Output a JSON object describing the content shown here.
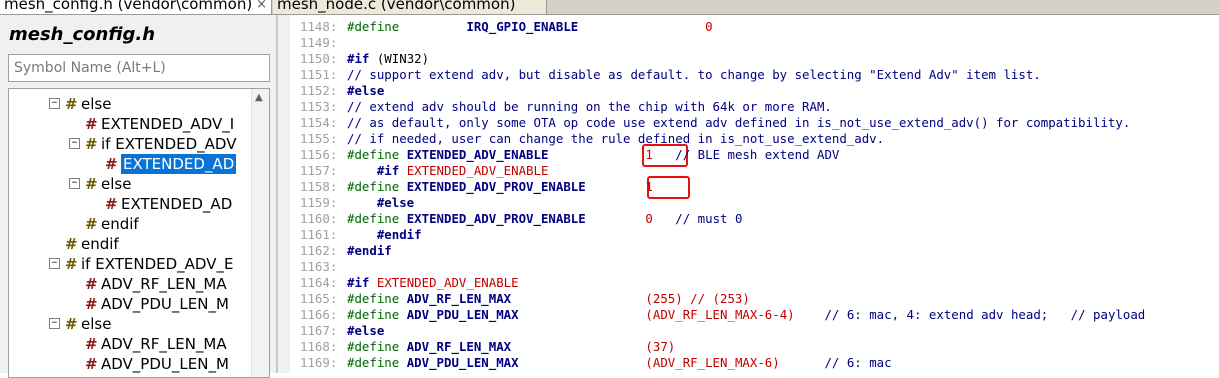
{
  "tabs": [
    {
      "label": "mesh_config.h (vendor\\common)",
      "active": true,
      "close": "×"
    },
    {
      "label": "mesh_node.c (vendor\\common)",
      "active": false
    }
  ],
  "sidebar": {
    "title": "mesh_config.h",
    "search_placeholder": "Symbol Name (Alt+L)",
    "tree": [
      {
        "label": "else",
        "kind": "cond",
        "expander": "−"
      },
      {
        "label": "EXTENDED_ADV_I",
        "kind": "def"
      },
      {
        "label": "if EXTENDED_ADV",
        "kind": "cond",
        "expander": "−"
      },
      {
        "label": "EXTENDED_AD",
        "kind": "def",
        "selected": true
      },
      {
        "label": "else",
        "kind": "cond",
        "expander": "−"
      },
      {
        "label": "EXTENDED_AD",
        "kind": "def"
      },
      {
        "label": "endif",
        "kind": "cond"
      },
      {
        "label": "endif",
        "kind": "cond"
      },
      {
        "label": "if EXTENDED_ADV_E",
        "kind": "cond",
        "expander": "−"
      },
      {
        "label": "ADV_RF_LEN_MA",
        "kind": "def"
      },
      {
        "label": "ADV_PDU_LEN_M",
        "kind": "def"
      },
      {
        "label": "else",
        "kind": "cond",
        "expander": "−"
      },
      {
        "label": "ADV_RF_LEN_MA",
        "kind": "def"
      },
      {
        "label": "ADV_PDU_LEN_M",
        "kind": "def"
      }
    ]
  },
  "editor": {
    "lines": [
      {
        "num": "1148:",
        "parts": [
          {
            "t": "#define",
            "c": "kw"
          },
          {
            "t": "         "
          },
          {
            "t": "IRQ_GPIO_ENABLE",
            "c": "mac"
          },
          {
            "t": "                 "
          },
          {
            "t": "0",
            "c": "num"
          }
        ]
      },
      {
        "num": "1149:",
        "parts": []
      },
      {
        "num": "1150:",
        "parts": [
          {
            "t": "#if",
            "c": "kwb"
          },
          {
            "t": " (WIN32)"
          }
        ]
      },
      {
        "num": "1151:",
        "parts": [
          {
            "t": "// support extend adv, but disable as default. to change by selecting \"Extend Adv\" item list.",
            "c": "cmt"
          }
        ]
      },
      {
        "num": "1152:",
        "parts": [
          {
            "t": "#else",
            "c": "kwb"
          }
        ]
      },
      {
        "num": "1153:",
        "parts": [
          {
            "t": "// extend adv should be running on the chip with 64k or more RAM.",
            "c": "cmt"
          }
        ]
      },
      {
        "num": "1154:",
        "parts": [
          {
            "t": "// as default, only some OTA op code use extend adv defined in is_not_use_extend_adv() for compatibility.",
            "c": "cmt"
          }
        ]
      },
      {
        "num": "1155:",
        "parts": [
          {
            "t": "// if needed, user can change the rule defined in is_not_use_extend_adv.",
            "c": "cmt"
          }
        ]
      },
      {
        "num": "1156:",
        "parts": [
          {
            "t": "#define",
            "c": "kw"
          },
          {
            "t": " "
          },
          {
            "t": "EXTENDED_ADV_ENABLE",
            "c": "mac"
          },
          {
            "t": "             "
          },
          {
            "t": "1",
            "c": "num"
          },
          {
            "t": "   "
          },
          {
            "t": "// BLE mesh extend ADV",
            "c": "cmt"
          }
        ]
      },
      {
        "num": "1157:",
        "parts": [
          {
            "t": "    "
          },
          {
            "t": "#if",
            "c": "kwb"
          },
          {
            "t": " "
          },
          {
            "t": "EXTENDED_ADV_ENABLE",
            "c": "red"
          }
        ]
      },
      {
        "num": "1158:",
        "parts": [
          {
            "t": "#define",
            "c": "kw"
          },
          {
            "t": " "
          },
          {
            "t": "EXTENDED_ADV_PROV_ENABLE",
            "c": "mac"
          },
          {
            "t": "        "
          },
          {
            "t": "1",
            "c": "num"
          }
        ]
      },
      {
        "num": "1159:",
        "parts": [
          {
            "t": "    "
          },
          {
            "t": "#else",
            "c": "kwb"
          }
        ]
      },
      {
        "num": "1160:",
        "parts": [
          {
            "t": "#define",
            "c": "kw"
          },
          {
            "t": " "
          },
          {
            "t": "EXTENDED_ADV_PROV_ENABLE",
            "c": "mac"
          },
          {
            "t": "        "
          },
          {
            "t": "0",
            "c": "num"
          },
          {
            "t": "   "
          },
          {
            "t": "// must 0",
            "c": "cmt"
          }
        ]
      },
      {
        "num": "1161:",
        "parts": [
          {
            "t": "    "
          },
          {
            "t": "#endif",
            "c": "kwb"
          }
        ]
      },
      {
        "num": "1162:",
        "parts": [
          {
            "t": "#endif",
            "c": "kwb"
          }
        ]
      },
      {
        "num": "1163:",
        "parts": []
      },
      {
        "num": "1164:",
        "parts": [
          {
            "t": "#if",
            "c": "kwb"
          },
          {
            "t": " "
          },
          {
            "t": "EXTENDED_ADV_ENABLE",
            "c": "red"
          }
        ]
      },
      {
        "num": "1165:",
        "parts": [
          {
            "t": "#define",
            "c": "kw"
          },
          {
            "t": " "
          },
          {
            "t": "ADV_RF_LEN_MAX",
            "c": "mac"
          },
          {
            "t": "                  "
          },
          {
            "t": "(255) // (253)",
            "c": "num"
          }
        ]
      },
      {
        "num": "1166:",
        "parts": [
          {
            "t": "#define",
            "c": "kw"
          },
          {
            "t": " "
          },
          {
            "t": "ADV_PDU_LEN_MAX",
            "c": "mac"
          },
          {
            "t": "                 "
          },
          {
            "t": "(ADV_RF_LEN_MAX-6-4)",
            "c": "num"
          },
          {
            "t": "    "
          },
          {
            "t": "// 6: mac, 4: extend adv head;   // payload",
            "c": "cmt"
          }
        ]
      },
      {
        "num": "1167:",
        "parts": [
          {
            "t": "#else",
            "c": "kwb"
          }
        ]
      },
      {
        "num": "1168:",
        "parts": [
          {
            "t": "#define",
            "c": "kw"
          },
          {
            "t": " "
          },
          {
            "t": "ADV_RF_LEN_MAX",
            "c": "mac"
          },
          {
            "t": "                  "
          },
          {
            "t": "(37)",
            "c": "num"
          }
        ]
      },
      {
        "num": "1169:",
        "parts": [
          {
            "t": "#define",
            "c": "kw"
          },
          {
            "t": " "
          },
          {
            "t": "ADV_PDU_LEN_MAX",
            "c": "mac"
          },
          {
            "t": "                 "
          },
          {
            "t": "(ADV_RF_LEN_MAX-6)",
            "c": "num"
          },
          {
            "t": "      "
          },
          {
            "t": "// 6: mac",
            "c": "cmt"
          }
        ]
      }
    ]
  }
}
